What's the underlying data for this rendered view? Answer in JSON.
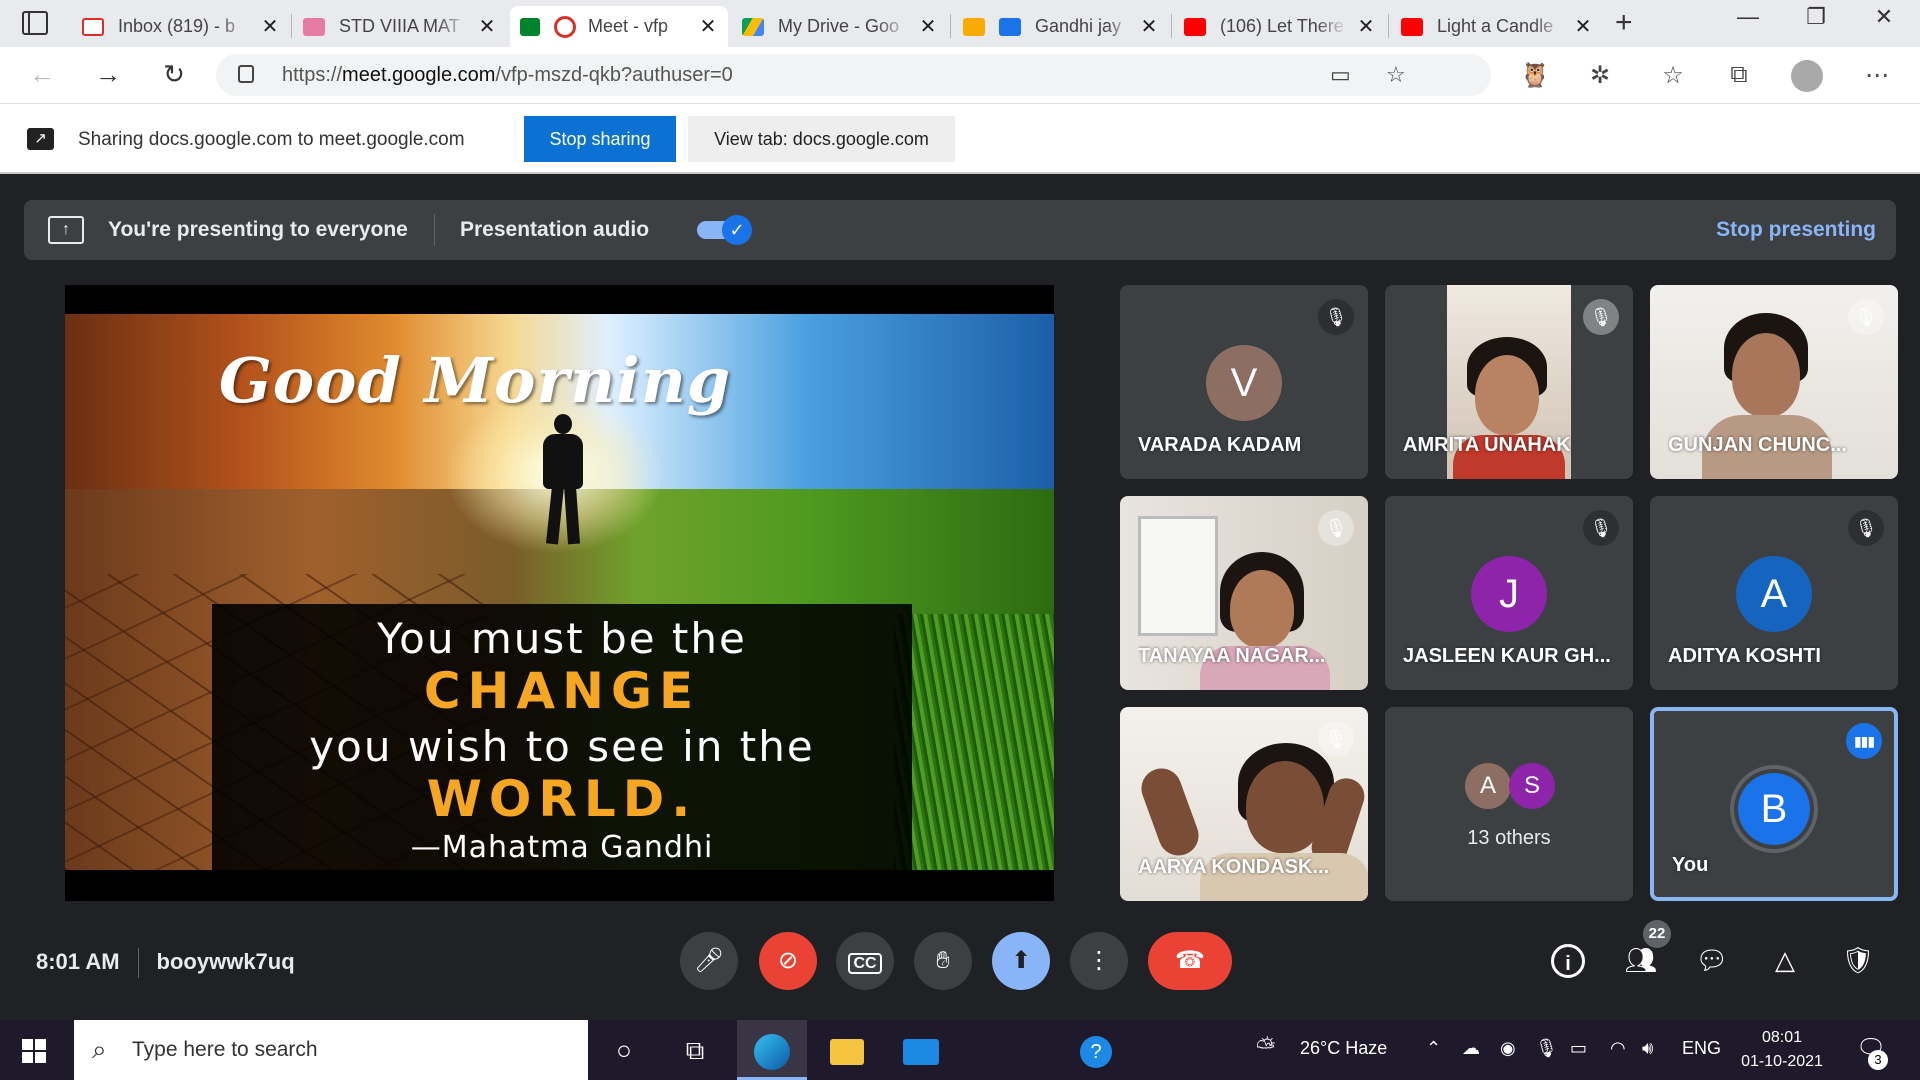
{
  "browser": {
    "tabs": [
      {
        "title": "Inbox (819) - b",
        "favicon_color": "#d93025",
        "favicon": "gmail-icon",
        "active": false
      },
      {
        "title": "STD VIIIA MAT",
        "favicon_color": "#e57ba1",
        "favicon": "classroom-icon",
        "active": false
      },
      {
        "title": "Meet - vfp",
        "favicon_color": "#00832d",
        "favicon": "meet-icon",
        "active": true
      },
      {
        "title": "My Drive - Goo",
        "favicon_color": "#fbbc04",
        "favicon": "drive-icon",
        "active": false
      },
      {
        "title": "Gandhi jay",
        "favicon_color": "#f9ab00",
        "favicon": "slides-icon",
        "active": false
      },
      {
        "title": "(106) Let There",
        "favicon_color": "#ff0000",
        "favicon": "youtube-icon",
        "active": false
      },
      {
        "title": "Light a Candle",
        "favicon_color": "#ff0000",
        "favicon": "youtube-icon",
        "active": false
      }
    ],
    "new_tab_glyph": "+",
    "url_prefix": "https://",
    "url_host": "meet.google.com",
    "url_path": "/vfp-mszd-qkb?authuser=0"
  },
  "share_bar": {
    "text": "Sharing docs.google.com to meet.google.com",
    "stop_label": "Stop sharing",
    "view_label": "View tab: docs.google.com"
  },
  "present_banner": {
    "text": "You're presenting to everyone",
    "audio_label": "Presentation audio",
    "audio_on": true,
    "stop_label": "Stop presenting"
  },
  "slide": {
    "greeting": "Good Morning",
    "line1": "You must be the",
    "line2": "CHANGE",
    "line3": "you wish to see in the",
    "line4": "WORLD.",
    "attribution": "—Mahatma Gandhi"
  },
  "participants": [
    {
      "name": "VARADA KADAM",
      "initial": "V",
      "avatar_color": "#8d6e63",
      "video": false,
      "muted": true
    },
    {
      "name": "AMRITA UNAHAK",
      "initial": "",
      "avatar_color": "",
      "video": true,
      "muted": true
    },
    {
      "name": "GUNJAN CHUNC...",
      "initial": "",
      "avatar_color": "",
      "video": true,
      "muted": true
    },
    {
      "name": "TANAYAA NAGAR...",
      "initial": "",
      "avatar_color": "",
      "video": true,
      "muted": true
    },
    {
      "name": "JASLEEN KAUR GH...",
      "initial": "J",
      "avatar_color": "#8e24aa",
      "video": false,
      "muted": true
    },
    {
      "name": "ADITYA KOSHTI",
      "initial": "A",
      "avatar_color": "#1565c0",
      "video": false,
      "muted": true
    },
    {
      "name": "AARYA KONDASK...",
      "initial": "",
      "avatar_color": "",
      "video": true,
      "muted": true
    }
  ],
  "others": {
    "avatar1": "A",
    "avatar1_color": "#8d6e63",
    "avatar2": "S",
    "avatar2_color": "#8e24aa",
    "label": "13 others"
  },
  "you": {
    "initial": "B",
    "avatar_color": "#1a73e8",
    "label": "You"
  },
  "controls": {
    "time": "8:01 AM",
    "meeting_code": "booywwk7uq",
    "participant_count": "22"
  },
  "taskbar": {
    "search_placeholder": "Type here to search",
    "weather": "26°C  Haze",
    "language": "ENG",
    "time": "08:01",
    "date": "01-10-2021",
    "notifications": "3"
  }
}
